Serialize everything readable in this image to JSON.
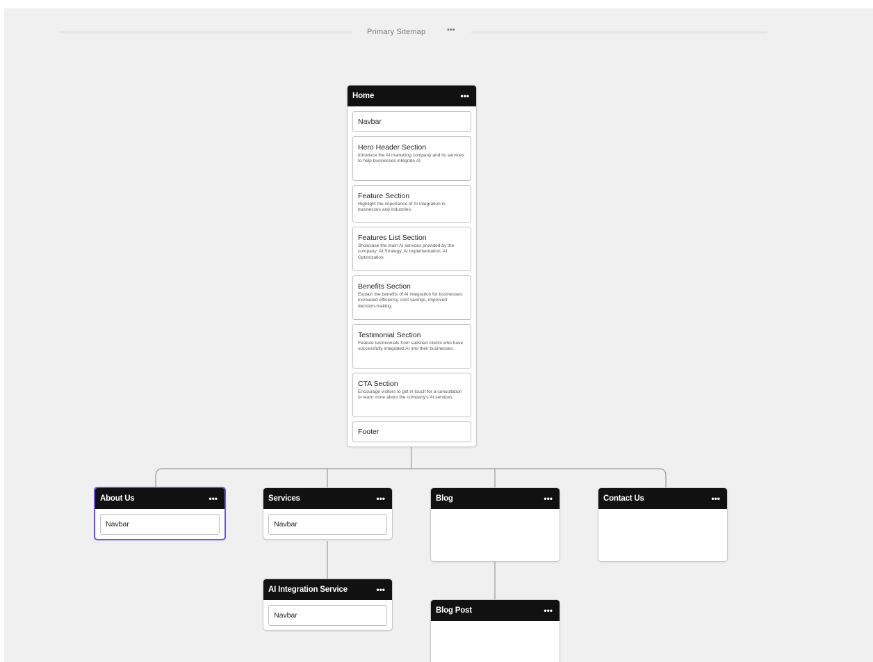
{
  "sitemap": {
    "title": "Primary Sitemap",
    "more_icon": "ellipsis-icon"
  },
  "pages": {
    "home": {
      "title": "Home",
      "sections": [
        {
          "title": "Navbar"
        },
        {
          "title": "Hero Header Section",
          "description": "Introduce the AI marketing company and its services to help businesses integrate AI."
        },
        {
          "title": "Feature Section",
          "description": "Highlight the importance of AI integration in businesses and industries."
        },
        {
          "title": "Features List Section",
          "description": "Showcase the main AI services provided by the company: AI Strategy, AI Implementation, AI Optimization."
        },
        {
          "title": "Benefits Section",
          "description": "Explain the benefits of AI integration for businesses: increased efficiency, cost savings, improved decision-making."
        },
        {
          "title": "Testimonial Section",
          "description": "Feature testimonials from satisfied clients who have successfully integrated AI into their businesses."
        },
        {
          "title": "CTA Section",
          "description": "Encourage visitors to get in touch for a consultation or learn more about the company's AI services."
        },
        {
          "title": "Footer"
        }
      ]
    },
    "about_us": {
      "title": "About Us",
      "sections": [
        {
          "title": "Navbar"
        }
      ]
    },
    "services": {
      "title": "Services",
      "sections": [
        {
          "title": "Navbar"
        }
      ]
    },
    "blog": {
      "title": "Blog",
      "sections": []
    },
    "contact_us": {
      "title": "Contact Us",
      "sections": []
    },
    "ai_integration_service": {
      "title": "AI Integration Service",
      "sections": [
        {
          "title": "Navbar"
        }
      ]
    },
    "blog_post": {
      "title": "Blog Post",
      "sections": []
    }
  },
  "colors": {
    "canvas": "#f0f0f0",
    "card_header": "#111111",
    "selected_outline": "#6f4ff2",
    "connector": "#9a9a9a"
  }
}
